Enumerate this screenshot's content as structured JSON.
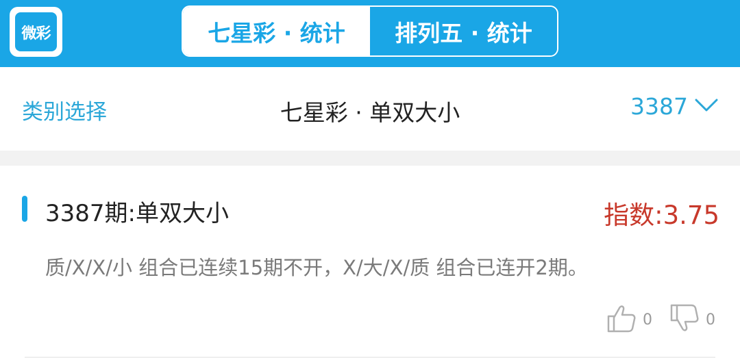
{
  "header": {
    "logo_text": "微彩",
    "tabs": [
      {
        "label": "七星彩 · 统计",
        "active": true
      },
      {
        "label": "排列五 · 统计",
        "active": false
      }
    ]
  },
  "filter": {
    "category_label": "类别选择",
    "title": "七星彩 · 单双大小",
    "period": "3387",
    "dropdown_icon": "chevron-down-icon"
  },
  "card": {
    "title": "3387期:单双大小",
    "index": "指数:3.75",
    "description": "质/X/X/小 组合已连续15期不开，X/大/X/质 组合已连开2期。",
    "likes": "0",
    "dislikes": "0"
  },
  "colors": {
    "brand": "#1aa6e6",
    "link": "#2ba7d8",
    "index_red": "#c8392b",
    "muted_text": "#7a7a7a"
  }
}
